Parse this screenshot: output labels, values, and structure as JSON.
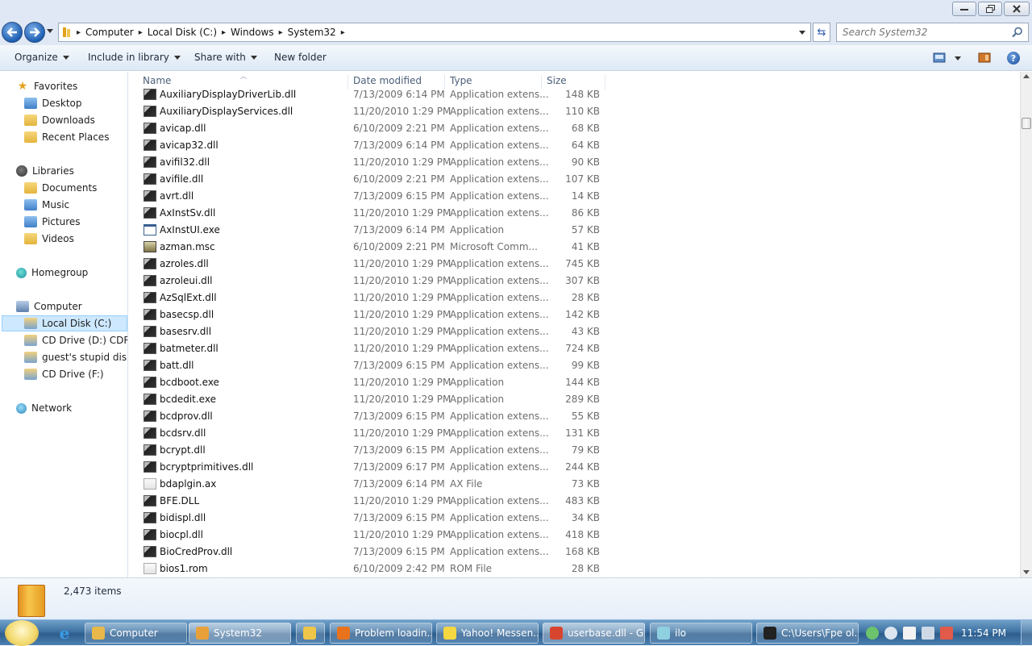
{
  "address": {
    "crumbs": [
      "Computer",
      "Local Disk (C:)",
      "Windows",
      "System32"
    ],
    "search_placeholder": "Search System32"
  },
  "toolbar": {
    "organize": "Organize",
    "include_in_library": "Include in library",
    "share_with": "Share with",
    "new_folder": "New folder"
  },
  "nav": {
    "favorites": "Favorites",
    "desktop": "Desktop",
    "downloads": "Downloads",
    "recent_places": "Recent Places",
    "libraries": "Libraries",
    "documents": "Documents",
    "music": "Music",
    "pictures": "Pictures",
    "videos": "Videos",
    "homegroup": "Homegroup",
    "computer": "Computer",
    "local_disk": "Local Disk (C:)",
    "cd_drive_d": "CD Drive (D:) CDROM",
    "guest_disk": "guest's stupid disk-u",
    "cd_drive_f": "CD Drive (F:)",
    "network": "Network"
  },
  "columns": {
    "name": "Name",
    "date_modified": "Date modified",
    "type": "Type",
    "size": "Size"
  },
  "files": [
    {
      "name": "AuxiliaryDisplayDriverLib.dll",
      "date": "7/13/2009 6:14 PM",
      "type": "Application extens...",
      "size": "148 KB",
      "icon": "dll"
    },
    {
      "name": "AuxiliaryDisplayServices.dll",
      "date": "11/20/2010 1:29 PM",
      "type": "Application extens...",
      "size": "110 KB",
      "icon": "dll"
    },
    {
      "name": "avicap.dll",
      "date": "6/10/2009 2:21 PM",
      "type": "Application extens...",
      "size": "68 KB",
      "icon": "dll"
    },
    {
      "name": "avicap32.dll",
      "date": "7/13/2009 6:14 PM",
      "type": "Application extens...",
      "size": "64 KB",
      "icon": "dll"
    },
    {
      "name": "avifil32.dll",
      "date": "11/20/2010 1:29 PM",
      "type": "Application extens...",
      "size": "90 KB",
      "icon": "dll"
    },
    {
      "name": "avifile.dll",
      "date": "6/10/2009 2:21 PM",
      "type": "Application extens...",
      "size": "107 KB",
      "icon": "dll"
    },
    {
      "name": "avrt.dll",
      "date": "7/13/2009 6:15 PM",
      "type": "Application extens...",
      "size": "14 KB",
      "icon": "dll"
    },
    {
      "name": "AxInstSv.dll",
      "date": "11/20/2010 1:29 PM",
      "type": "Application extens...",
      "size": "86 KB",
      "icon": "dll"
    },
    {
      "name": "AxInstUI.exe",
      "date": "7/13/2009 6:14 PM",
      "type": "Application",
      "size": "57 KB",
      "icon": "exe"
    },
    {
      "name": "azman.msc",
      "date": "6/10/2009 2:21 PM",
      "type": "Microsoft Comm...",
      "size": "41 KB",
      "icon": "msc"
    },
    {
      "name": "azroles.dll",
      "date": "11/20/2010 1:29 PM",
      "type": "Application extens...",
      "size": "745 KB",
      "icon": "dll"
    },
    {
      "name": "azroleui.dll",
      "date": "11/20/2010 1:29 PM",
      "type": "Application extens...",
      "size": "307 KB",
      "icon": "dll"
    },
    {
      "name": "AzSqlExt.dll",
      "date": "11/20/2010 1:29 PM",
      "type": "Application extens...",
      "size": "28 KB",
      "icon": "dll"
    },
    {
      "name": "basecsp.dll",
      "date": "11/20/2010 1:29 PM",
      "type": "Application extens...",
      "size": "142 KB",
      "icon": "dll"
    },
    {
      "name": "basesrv.dll",
      "date": "11/20/2010 1:29 PM",
      "type": "Application extens...",
      "size": "43 KB",
      "icon": "dll"
    },
    {
      "name": "batmeter.dll",
      "date": "11/20/2010 1:29 PM",
      "type": "Application extens...",
      "size": "724 KB",
      "icon": "dll"
    },
    {
      "name": "batt.dll",
      "date": "7/13/2009 6:15 PM",
      "type": "Application extens...",
      "size": "99 KB",
      "icon": "dll"
    },
    {
      "name": "bcdboot.exe",
      "date": "11/20/2010 1:29 PM",
      "type": "Application",
      "size": "144 KB",
      "icon": "dll"
    },
    {
      "name": "bcdedit.exe",
      "date": "11/20/2010 1:29 PM",
      "type": "Application",
      "size": "289 KB",
      "icon": "dll"
    },
    {
      "name": "bcdprov.dll",
      "date": "7/13/2009 6:15 PM",
      "type": "Application extens...",
      "size": "55 KB",
      "icon": "dll"
    },
    {
      "name": "bcdsrv.dll",
      "date": "11/20/2010 1:29 PM",
      "type": "Application extens...",
      "size": "131 KB",
      "icon": "dll"
    },
    {
      "name": "bcrypt.dll",
      "date": "7/13/2009 6:15 PM",
      "type": "Application extens...",
      "size": "79 KB",
      "icon": "dll"
    },
    {
      "name": "bcryptprimitives.dll",
      "date": "7/13/2009 6:17 PM",
      "type": "Application extens...",
      "size": "244 KB",
      "icon": "dll"
    },
    {
      "name": "bdaplgin.ax",
      "date": "7/13/2009 6:14 PM",
      "type": "AX File",
      "size": "73 KB",
      "icon": "file"
    },
    {
      "name": "BFE.DLL",
      "date": "11/20/2010 1:29 PM",
      "type": "Application extens...",
      "size": "483 KB",
      "icon": "dll"
    },
    {
      "name": "bidispl.dll",
      "date": "7/13/2009 6:15 PM",
      "type": "Application extens...",
      "size": "34 KB",
      "icon": "dll"
    },
    {
      "name": "biocpl.dll",
      "date": "11/20/2010 1:29 PM",
      "type": "Application extens...",
      "size": "418 KB",
      "icon": "dll"
    },
    {
      "name": "BioCredProv.dll",
      "date": "7/13/2009 6:15 PM",
      "type": "Application extens...",
      "size": "168 KB",
      "icon": "dll"
    },
    {
      "name": "bios1.rom",
      "date": "6/10/2009 2:42 PM",
      "type": "ROM File",
      "size": "28 KB",
      "icon": "file"
    }
  ],
  "details": {
    "item_count": "2,473 items"
  },
  "taskbar": {
    "tasks": [
      {
        "label": "Computer",
        "color": "#e8b84a"
      },
      {
        "label": "System32",
        "color": "#e8a13a"
      },
      {
        "label": "",
        "color": "#f0c64a"
      },
      {
        "label": "Problem loadin...",
        "color": "#e8731c"
      },
      {
        "label": "Yahoo! Messen...",
        "color": "#f5d742"
      },
      {
        "label": "userbase.dll - G...",
        "color": "#d8452e"
      },
      {
        "label": "ilo",
        "color": "#8fd0e0"
      },
      {
        "label": "C:\\Users\\Fpe ol...",
        "color": "#222222"
      }
    ],
    "clock": "11:54 PM"
  }
}
